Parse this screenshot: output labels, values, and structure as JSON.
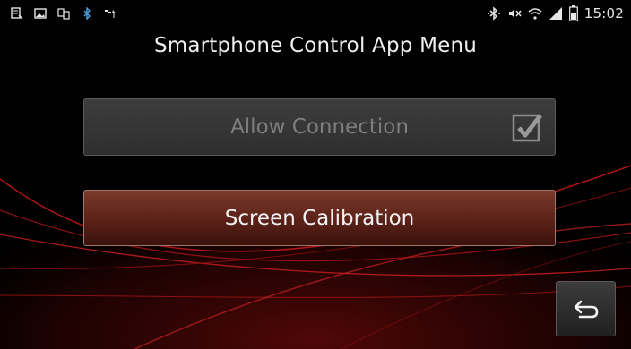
{
  "status_bar": {
    "time": "15:02",
    "left_icons": [
      "notes-icon",
      "image-icon",
      "sim-transfer-icon",
      "bluetooth-icon",
      "mobile-data-icon"
    ],
    "right_icons": [
      "bluetooth-icon",
      "mute-icon",
      "wifi-icon",
      "signal-icon",
      "battery-icon"
    ]
  },
  "screen": {
    "title": "Smartphone Control App Menu"
  },
  "menu": {
    "allow_connection_label": "Allow Connection",
    "allow_connection_checked": true,
    "screen_calibration_label": "Screen Calibration"
  },
  "navigation": {
    "back_icon": "back-icon"
  },
  "colors": {
    "accent_red": "#7a1010",
    "button_red": "#5e2319",
    "disabled_text": "#7e7e7e"
  }
}
